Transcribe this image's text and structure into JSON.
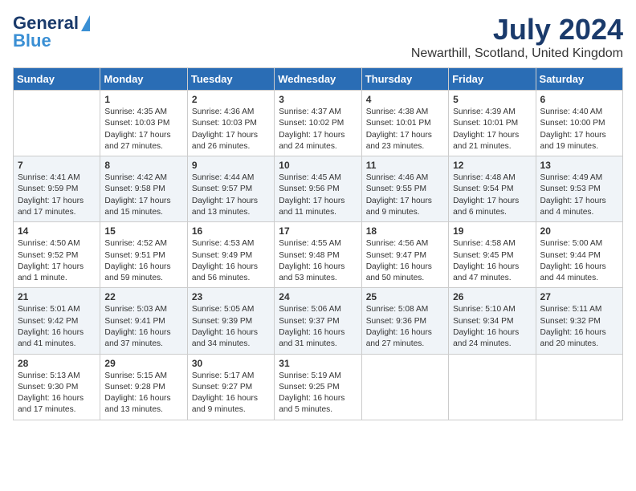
{
  "logo": {
    "general": "General",
    "blue": "Blue"
  },
  "title": "July 2024",
  "subtitle": "Newarthill, Scotland, United Kingdom",
  "days": [
    "Sunday",
    "Monday",
    "Tuesday",
    "Wednesday",
    "Thursday",
    "Friday",
    "Saturday"
  ],
  "weeks": [
    [
      {
        "day": "",
        "content": ""
      },
      {
        "day": "1",
        "content": "Sunrise: 4:35 AM\nSunset: 10:03 PM\nDaylight: 17 hours\nand 27 minutes."
      },
      {
        "day": "2",
        "content": "Sunrise: 4:36 AM\nSunset: 10:03 PM\nDaylight: 17 hours\nand 26 minutes."
      },
      {
        "day": "3",
        "content": "Sunrise: 4:37 AM\nSunset: 10:02 PM\nDaylight: 17 hours\nand 24 minutes."
      },
      {
        "day": "4",
        "content": "Sunrise: 4:38 AM\nSunset: 10:01 PM\nDaylight: 17 hours\nand 23 minutes."
      },
      {
        "day": "5",
        "content": "Sunrise: 4:39 AM\nSunset: 10:01 PM\nDaylight: 17 hours\nand 21 minutes."
      },
      {
        "day": "6",
        "content": "Sunrise: 4:40 AM\nSunset: 10:00 PM\nDaylight: 17 hours\nand 19 minutes."
      }
    ],
    [
      {
        "day": "7",
        "content": "Sunrise: 4:41 AM\nSunset: 9:59 PM\nDaylight: 17 hours\nand 17 minutes."
      },
      {
        "day": "8",
        "content": "Sunrise: 4:42 AM\nSunset: 9:58 PM\nDaylight: 17 hours\nand 15 minutes."
      },
      {
        "day": "9",
        "content": "Sunrise: 4:44 AM\nSunset: 9:57 PM\nDaylight: 17 hours\nand 13 minutes."
      },
      {
        "day": "10",
        "content": "Sunrise: 4:45 AM\nSunset: 9:56 PM\nDaylight: 17 hours\nand 11 minutes."
      },
      {
        "day": "11",
        "content": "Sunrise: 4:46 AM\nSunset: 9:55 PM\nDaylight: 17 hours\nand 9 minutes."
      },
      {
        "day": "12",
        "content": "Sunrise: 4:48 AM\nSunset: 9:54 PM\nDaylight: 17 hours\nand 6 minutes."
      },
      {
        "day": "13",
        "content": "Sunrise: 4:49 AM\nSunset: 9:53 PM\nDaylight: 17 hours\nand 4 minutes."
      }
    ],
    [
      {
        "day": "14",
        "content": "Sunrise: 4:50 AM\nSunset: 9:52 PM\nDaylight: 17 hours\nand 1 minute."
      },
      {
        "day": "15",
        "content": "Sunrise: 4:52 AM\nSunset: 9:51 PM\nDaylight: 16 hours\nand 59 minutes."
      },
      {
        "day": "16",
        "content": "Sunrise: 4:53 AM\nSunset: 9:49 PM\nDaylight: 16 hours\nand 56 minutes."
      },
      {
        "day": "17",
        "content": "Sunrise: 4:55 AM\nSunset: 9:48 PM\nDaylight: 16 hours\nand 53 minutes."
      },
      {
        "day": "18",
        "content": "Sunrise: 4:56 AM\nSunset: 9:47 PM\nDaylight: 16 hours\nand 50 minutes."
      },
      {
        "day": "19",
        "content": "Sunrise: 4:58 AM\nSunset: 9:45 PM\nDaylight: 16 hours\nand 47 minutes."
      },
      {
        "day": "20",
        "content": "Sunrise: 5:00 AM\nSunset: 9:44 PM\nDaylight: 16 hours\nand 44 minutes."
      }
    ],
    [
      {
        "day": "21",
        "content": "Sunrise: 5:01 AM\nSunset: 9:42 PM\nDaylight: 16 hours\nand 41 minutes."
      },
      {
        "day": "22",
        "content": "Sunrise: 5:03 AM\nSunset: 9:41 PM\nDaylight: 16 hours\nand 37 minutes."
      },
      {
        "day": "23",
        "content": "Sunrise: 5:05 AM\nSunset: 9:39 PM\nDaylight: 16 hours\nand 34 minutes."
      },
      {
        "day": "24",
        "content": "Sunrise: 5:06 AM\nSunset: 9:37 PM\nDaylight: 16 hours\nand 31 minutes."
      },
      {
        "day": "25",
        "content": "Sunrise: 5:08 AM\nSunset: 9:36 PM\nDaylight: 16 hours\nand 27 minutes."
      },
      {
        "day": "26",
        "content": "Sunrise: 5:10 AM\nSunset: 9:34 PM\nDaylight: 16 hours\nand 24 minutes."
      },
      {
        "day": "27",
        "content": "Sunrise: 5:11 AM\nSunset: 9:32 PM\nDaylight: 16 hours\nand 20 minutes."
      }
    ],
    [
      {
        "day": "28",
        "content": "Sunrise: 5:13 AM\nSunset: 9:30 PM\nDaylight: 16 hours\nand 17 minutes."
      },
      {
        "day": "29",
        "content": "Sunrise: 5:15 AM\nSunset: 9:28 PM\nDaylight: 16 hours\nand 13 minutes."
      },
      {
        "day": "30",
        "content": "Sunrise: 5:17 AM\nSunset: 9:27 PM\nDaylight: 16 hours\nand 9 minutes."
      },
      {
        "day": "31",
        "content": "Sunrise: 5:19 AM\nSunset: 9:25 PM\nDaylight: 16 hours\nand 5 minutes."
      },
      {
        "day": "",
        "content": ""
      },
      {
        "day": "",
        "content": ""
      },
      {
        "day": "",
        "content": ""
      }
    ]
  ]
}
